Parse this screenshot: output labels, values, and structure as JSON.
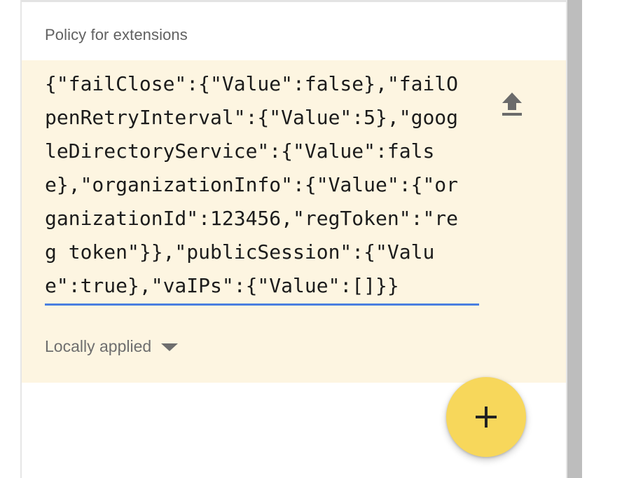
{
  "policy_section": {
    "title": "Policy for extensions",
    "value": "{\"failClose\":{\"Value\":false},\"failOpenRetryInterval\":{\"Value\":5},\"googleDirectoryService\":{\"Value\":false},\"organizationInfo\":{\"Value\":{\"organizationId\":123456,\"regToken\":\"reg token\"}},\"publicSession\":{\"Value\":true},\"vaIPs\":{\"Value\":[]}}",
    "upload_icon": "upload-icon",
    "status_label": "Locally applied",
    "status_icon": "caret-down-icon",
    "background_color": "#fdf5e1",
    "focus_underline_color": "#4a7fe0"
  },
  "fab": {
    "icon": "plus-icon",
    "color": "#f7d75b"
  }
}
